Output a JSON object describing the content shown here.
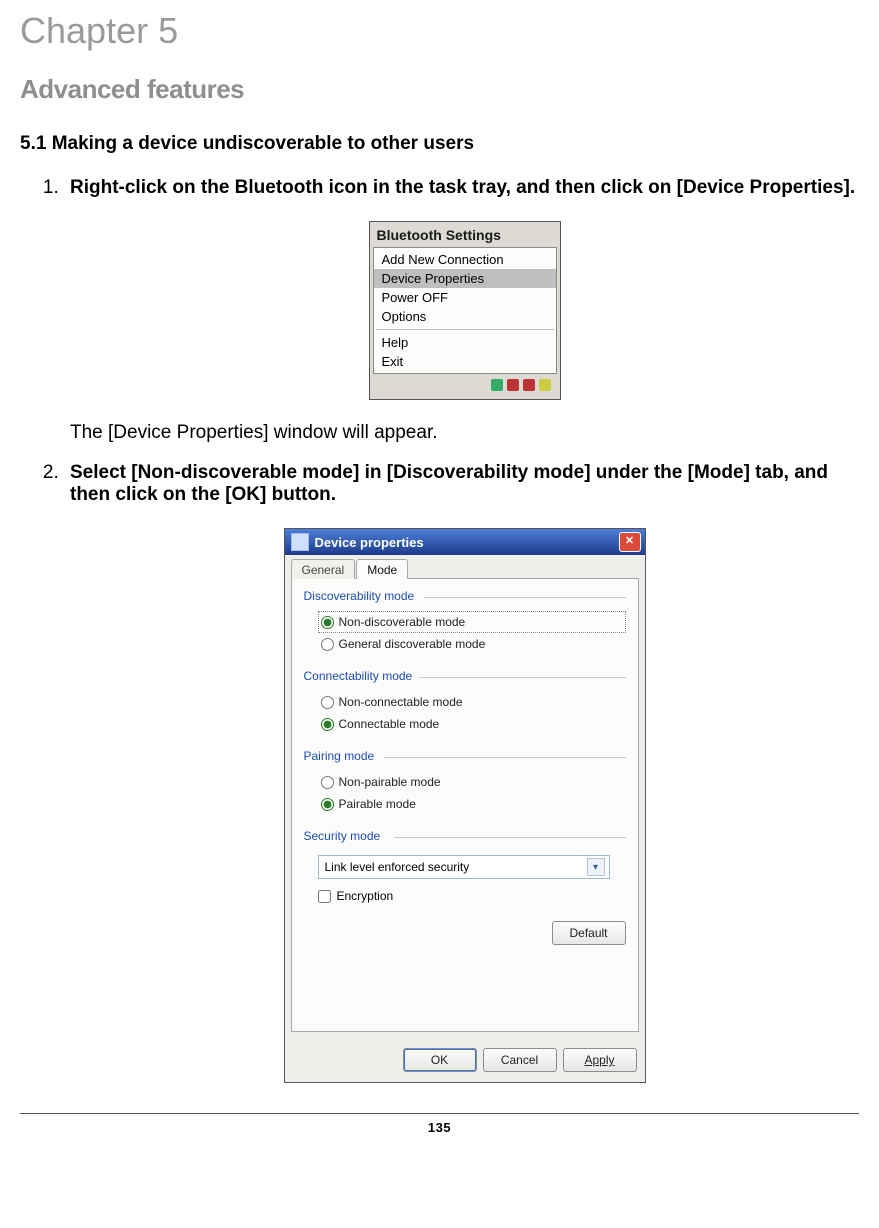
{
  "chapter_title": "Chapter 5",
  "section_title": "Advanced features",
  "subsection": "5.1  Making a device undiscoverable to other users",
  "steps": {
    "s1_bold": "Right-click on the Bluetooth icon in the task tray, and then click on [Device Properties].",
    "s1_after": "The [Device Properties] window will appear.",
    "s2_bold": "Select [Non-discoverable mode] in [Discoverability mode] under the [Mode] tab, and then click on the [OK] button."
  },
  "context_menu": {
    "title": "Bluetooth Settings",
    "items": [
      "Add New Connection",
      "Device Properties",
      "Power OFF",
      "Options"
    ],
    "items2": [
      "Help",
      "Exit"
    ],
    "selected_index": 1
  },
  "dialog": {
    "title": "Device properties",
    "tabs": {
      "general": "General",
      "mode": "Mode"
    },
    "discoverability": {
      "title": "Discoverability mode",
      "opt1": "Non-discoverable mode",
      "opt2": "General discoverable mode"
    },
    "connectability": {
      "title": "Connectability mode",
      "opt1": "Non-connectable mode",
      "opt2": "Connectable mode"
    },
    "pairing": {
      "title": "Pairing mode",
      "opt1": "Non-pairable mode",
      "opt2": "Pairable mode"
    },
    "security": {
      "title": "Security mode",
      "select_value": "Link level enforced security",
      "encryption": "Encryption"
    },
    "buttons": {
      "default": "Default",
      "ok": "OK",
      "cancel": "Cancel",
      "apply": "Apply"
    }
  },
  "page_number": "135"
}
